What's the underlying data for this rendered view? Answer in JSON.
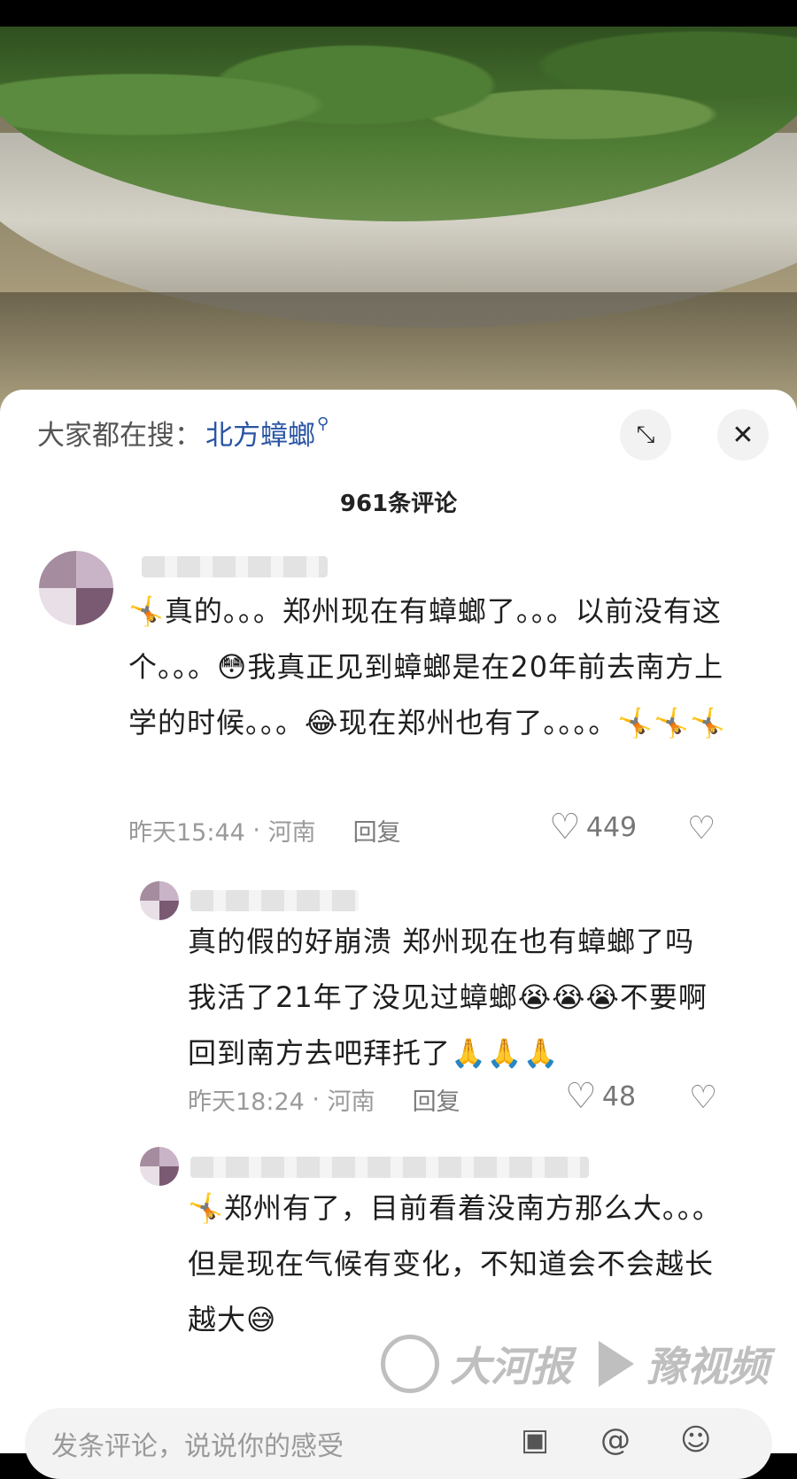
{
  "header": {
    "search_prefix": "大家都在搜：",
    "search_term": "北方蟑螂",
    "search_icon": "search-icon",
    "expand_icon": "expand-icon",
    "close_icon": "close-icon",
    "comment_count": "961条评论"
  },
  "comments": [
    {
      "text": "🤸真的。。。郑州现在有蟑螂了。。。以前没有这个。。。😳我真正见到蟑螂是在20年前去南方上学的时候。。。😂现在郑州也有了。。。。🤸🤸🤸",
      "time": "昨天15:44",
      "location": "河南",
      "reply": "回复",
      "likes": "449"
    },
    {
      "text": "真的假的好崩溃 郑州现在也有蟑螂了吗 我活了21年了没见过蟑螂😭😭😭不要啊 回到南方去吧拜托了🙏🙏🙏",
      "time": "昨天18:24",
      "location": "河南",
      "reply": "回复",
      "likes": "48"
    },
    {
      "text": "🤸郑州有了，目前看着没南方那么大。。。但是现在气候有变化，不知道会不会越长越大😅"
    }
  ],
  "input": {
    "placeholder": "发条评论，说说你的感受"
  },
  "watermark": {
    "brand_1": "大河报",
    "brand_2": "豫视频"
  },
  "colors": {
    "link_blue": "#2a55a4",
    "meta_gray": "#9a9a9a"
  }
}
